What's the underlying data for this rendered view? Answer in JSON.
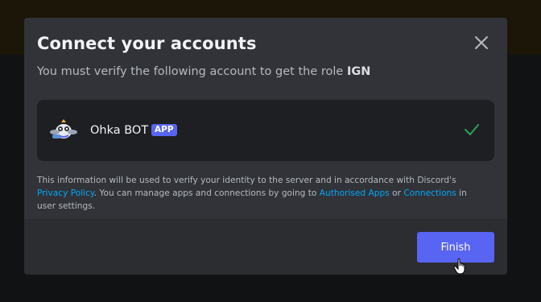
{
  "modal": {
    "title": "Connect your accounts",
    "subtitle_prefix": "You must verify the following account to get the role ",
    "role_name": "IGN"
  },
  "account": {
    "name": "Ohka BOT",
    "badge": "APP",
    "verified": true
  },
  "info": {
    "text_1": "This information will be used to verify your identity to the server and in accordance with Discord's ",
    "privacy_link": "Privacy Policy",
    "text_2": ". You can manage apps and connections by going to ",
    "apps_link": "Authorised Apps",
    "text_3": " or ",
    "connections_link": "Connections",
    "text_4": " in user settings."
  },
  "footer": {
    "finish_label": "Finish"
  },
  "colors": {
    "accent": "#5865f2",
    "link": "#00a8fc",
    "success": "#23a55a"
  },
  "icons": {
    "close": "close-icon",
    "check": "check-icon",
    "avatar": "bot-avatar-icon",
    "cursor": "hand-pointer-icon"
  }
}
